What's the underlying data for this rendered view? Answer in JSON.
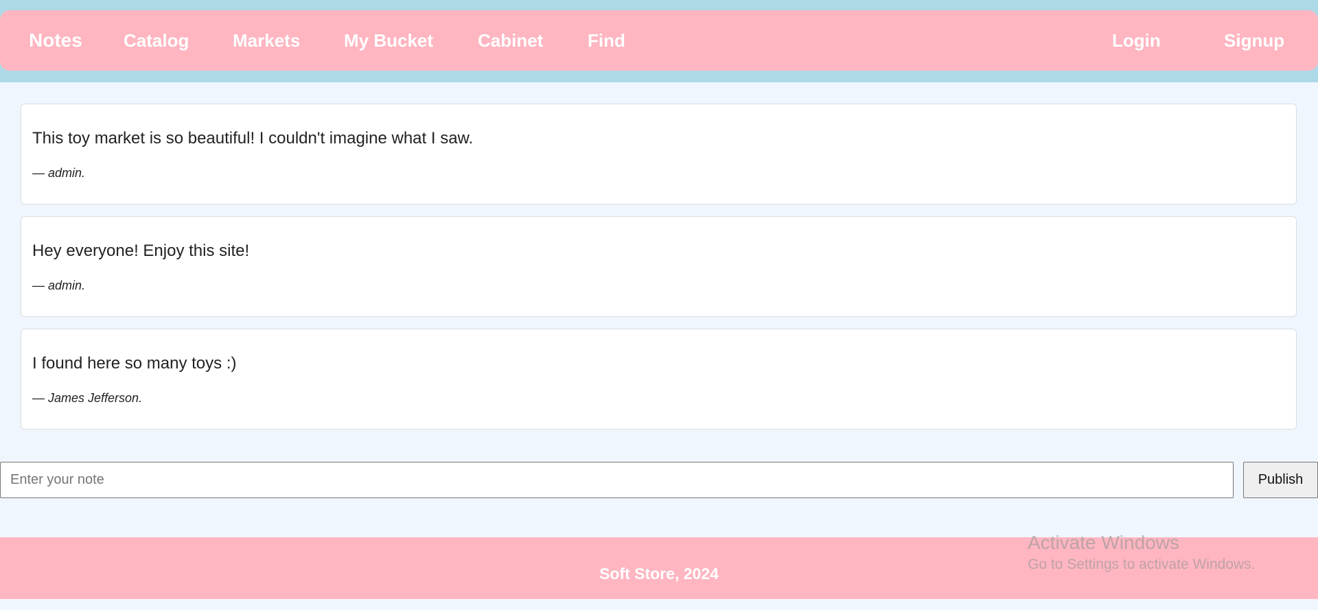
{
  "nav": {
    "brand": "Notes",
    "links": [
      "Catalog",
      "Markets",
      "My Bucket",
      "Cabinet",
      "Find"
    ],
    "login": "Login",
    "signup": "Signup"
  },
  "notes": [
    {
      "text": "This toy market is so beautiful! I couldn't imagine what I saw.",
      "dash": "— ",
      "author": "admin."
    },
    {
      "text": "Hey everyone! Enjoy this site!",
      "dash": "— ",
      "author": "admin."
    },
    {
      "text": "I found here so many toys :)",
      "dash": "— ",
      "author": "James Jefferson."
    }
  ],
  "compose": {
    "placeholder": "Enter your note",
    "value": "",
    "publish_label": "Publish"
  },
  "footer": {
    "text": "Soft Store, 2024"
  },
  "watermark": {
    "title": "Activate Windows",
    "subtitle": "Go to Settings to activate Windows."
  },
  "colors": {
    "nav_bg": "#ffb6c1",
    "top_band": "#add8e6",
    "page_bg": "#f0f6fd",
    "footer_bg": "#ffb6c1"
  }
}
